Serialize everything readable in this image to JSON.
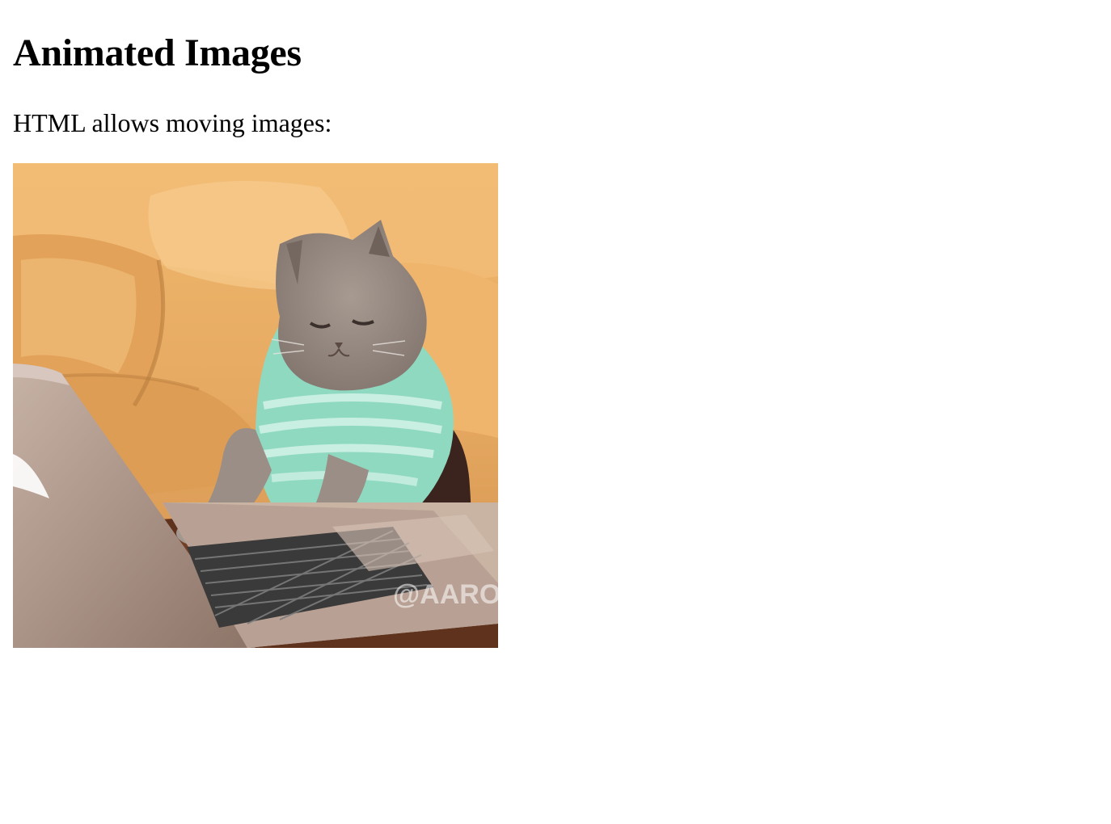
{
  "page": {
    "heading": "Animated Images",
    "intro": "HTML allows moving images:"
  },
  "image": {
    "subject": "cat typing on laptop",
    "watermark": "@AARON",
    "colors": {
      "couch": "#e6a962",
      "couch_highlight": "#f5c98a",
      "couch_shadow": "#b97d3e",
      "cat_fur": "#9a8e86",
      "cat_shirt": "#8fd9c0",
      "laptop": "#b59f93",
      "laptop_keys": "#3a3a3a",
      "table": "#6b3a22"
    }
  }
}
